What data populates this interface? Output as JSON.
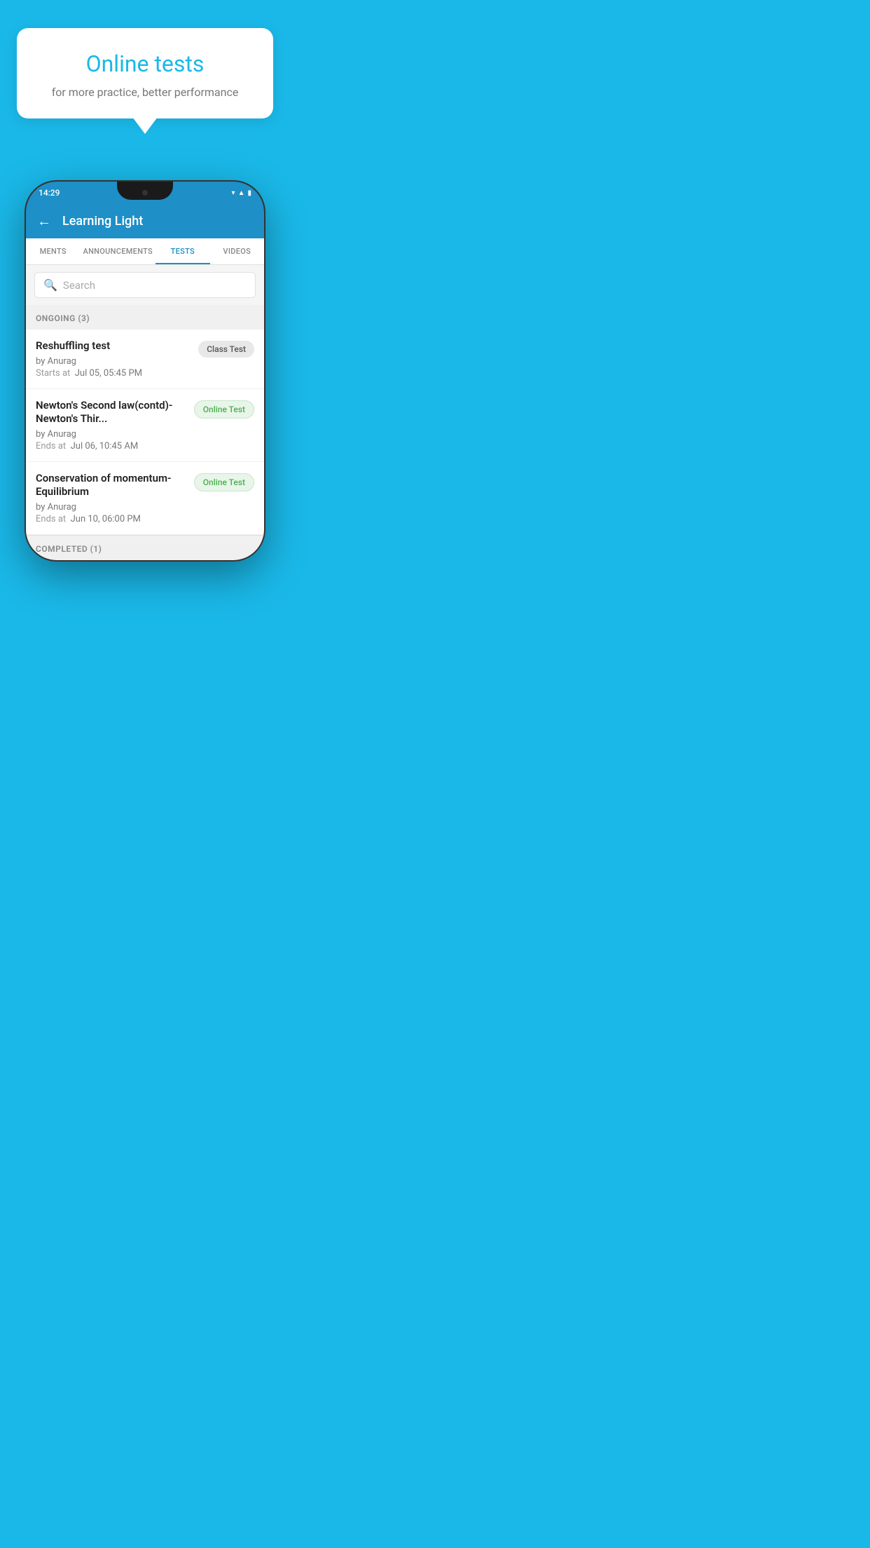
{
  "background_color": "#1ab8e8",
  "bubble": {
    "title": "Online tests",
    "subtitle": "for more practice, better performance"
  },
  "phone": {
    "status_bar": {
      "time": "14:29",
      "icons": [
        "wifi",
        "signal",
        "battery"
      ]
    },
    "header": {
      "title": "Learning Light",
      "back_label": "←"
    },
    "tabs": [
      {
        "label": "MENTS",
        "active": false
      },
      {
        "label": "ANNOUNCEMENTS",
        "active": false
      },
      {
        "label": "TESTS",
        "active": true
      },
      {
        "label": "VIDEOS",
        "active": false
      }
    ],
    "search": {
      "placeholder": "Search"
    },
    "ongoing_section": {
      "label": "ONGOING (3)"
    },
    "tests": [
      {
        "name": "Reshuffling test",
        "author": "by Anurag",
        "time_label": "Starts at",
        "time": "Jul 05, 05:45 PM",
        "tag": "Class Test",
        "tag_type": "class"
      },
      {
        "name": "Newton's Second law(contd)-Newton's Thir...",
        "author": "by Anurag",
        "time_label": "Ends at",
        "time": "Jul 06, 10:45 AM",
        "tag": "Online Test",
        "tag_type": "online"
      },
      {
        "name": "Conservation of momentum-Equilibrium",
        "author": "by Anurag",
        "time_label": "Ends at",
        "time": "Jun 10, 06:00 PM",
        "tag": "Online Test",
        "tag_type": "online"
      }
    ],
    "completed_section": {
      "label": "COMPLETED (1)"
    }
  }
}
